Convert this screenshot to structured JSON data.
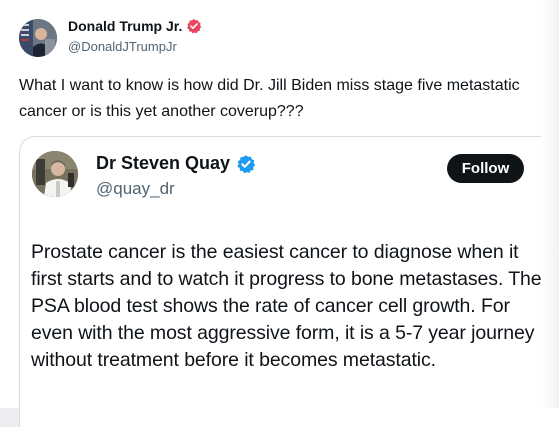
{
  "outer_post": {
    "author_name": "Donald Trump Jr.",
    "author_handle": "@DonaldJTrumpJr",
    "text": "What I want to know is how did Dr. Jill Biden miss stage five metastatic cancer or is this yet another coverup???",
    "verified_badge": {
      "icon": "verified-badge-icon",
      "color": "#e8475f"
    }
  },
  "quoted_post": {
    "author_name": "Dr Steven Quay",
    "author_handle": "@quay_dr",
    "follow_label": "Follow",
    "text": "Prostate cancer is the easiest cancer to diagnose when it first starts and to watch it progress to bone metastases. The PSA blood test shows the rate of cancer cell growth. For even with the most aggressive form, it is a 5-7 year journey without treatment before it becomes metastatic.",
    "verified_badge": {
      "icon": "verified-badge-icon",
      "color": "#1d9bf0"
    }
  },
  "colors": {
    "text_primary": "#0f1419",
    "text_secondary": "#536471",
    "follow_button_bg": "#0f1419",
    "follow_button_text": "#ffffff"
  }
}
